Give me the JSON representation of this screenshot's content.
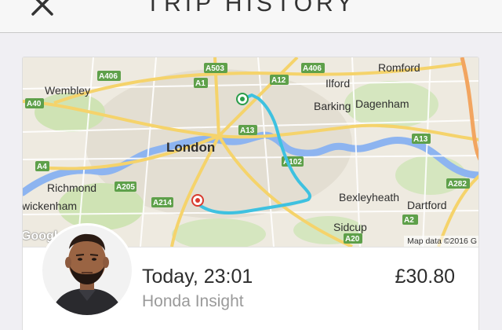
{
  "header": {
    "title": "TRIP HISTORY",
    "close_icon": "close-icon"
  },
  "map": {
    "places": {
      "wembley": "Wembley",
      "london": "London",
      "richmond": "Richmond",
      "twickenham": "wickenham",
      "ilford": "Ilford",
      "romford": "Romford",
      "barking": "Barking",
      "dagenham": "Dagenham",
      "bexleyheath": "Bexleyheath",
      "dartford": "Dartford",
      "sidcup": "Sidcup"
    },
    "roads": {
      "a406_w": "A406",
      "a503": "A503",
      "a406_e": "A406",
      "a1": "A1",
      "a12": "A12",
      "a40": "A40",
      "a13_w": "A13",
      "a13_e": "A13",
      "a102": "A102",
      "a4": "A4",
      "a205": "A205",
      "a214": "A214",
      "a282": "A282",
      "a2": "A2",
      "a20": "A20"
    },
    "copyright": "Map data ©2016 G",
    "logo": "Google",
    "route_color": "#3ec1e0",
    "start_marker_color": "#2a9d4a",
    "end_marker_color": "#d93b2f"
  },
  "trip": {
    "time": "Today, 23:01",
    "car": "Honda Insight",
    "fare": "£30.80"
  }
}
